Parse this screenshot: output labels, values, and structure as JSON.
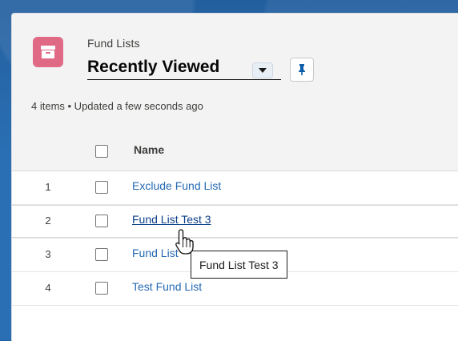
{
  "header": {
    "object_label": "Fund Lists",
    "list_view_title": "Recently Viewed",
    "meta_text": "4 items • Updated a few seconds ago",
    "icons": {
      "object": "archive-icon",
      "dropdown": "chevron-down-icon",
      "pin": "pin-icon"
    }
  },
  "table": {
    "column_header": "Name",
    "rows": [
      {
        "number": "1",
        "name": "Exclude Fund List"
      },
      {
        "number": "2",
        "name": "Fund List Test 3"
      },
      {
        "number": "3",
        "name": "Fund List"
      },
      {
        "number": "4",
        "name": "Test Fund List"
      }
    ]
  },
  "tooltip": {
    "text": "Fund List Test 3"
  },
  "colors": {
    "object_icon": "#e06a86",
    "link": "#2469b3",
    "background": "#2a6fb3"
  }
}
